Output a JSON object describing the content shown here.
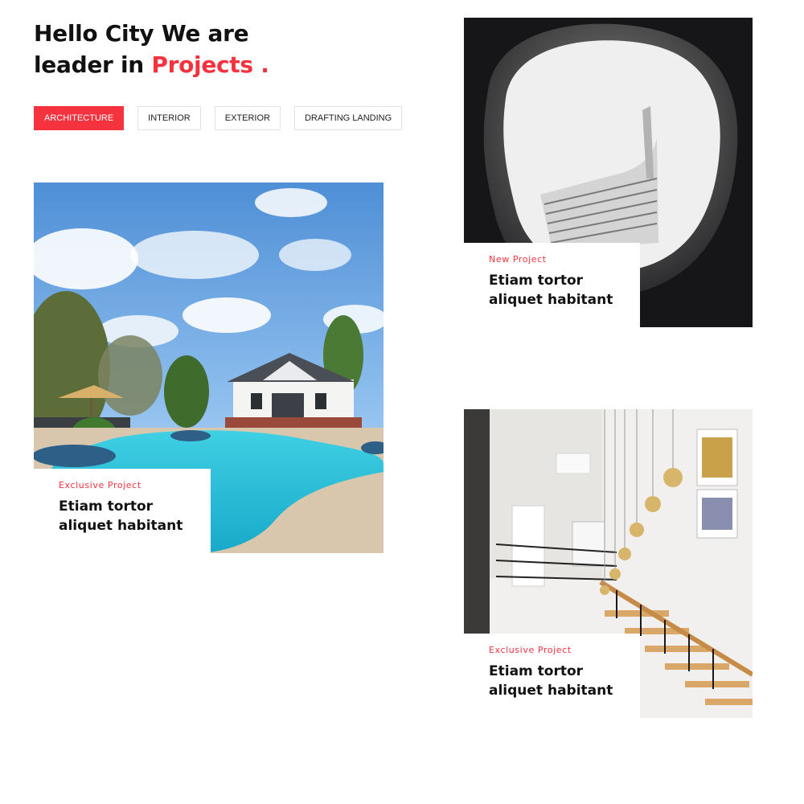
{
  "heading": {
    "line1": "Hello City We are",
    "line2_prefix": "leader in ",
    "line2_accent": "Projects ."
  },
  "filters": [
    {
      "label": "ARCHITECTURE",
      "active": true
    },
    {
      "label": "INTERIOR",
      "active": false
    },
    {
      "label": "EXTERIOR",
      "active": false
    },
    {
      "label": "DRAFTING LANDING",
      "active": false
    }
  ],
  "projects": [
    {
      "tag": "Exclusive Project",
      "title": "Etiam tortor aliquet habitant",
      "photo": "backyard-pool-house"
    },
    {
      "tag": "New Project",
      "title": "Etiam tortor aliquet habitant",
      "photo": "skyscraper-looking-up"
    },
    {
      "tag": "Exclusive Project",
      "title": "Etiam tortor aliquet habitant",
      "photo": "interior-staircase-pendant-lights"
    }
  ],
  "colors": {
    "accent": "#f5333f",
    "text": "#111111",
    "border": "#e2e2e2"
  }
}
